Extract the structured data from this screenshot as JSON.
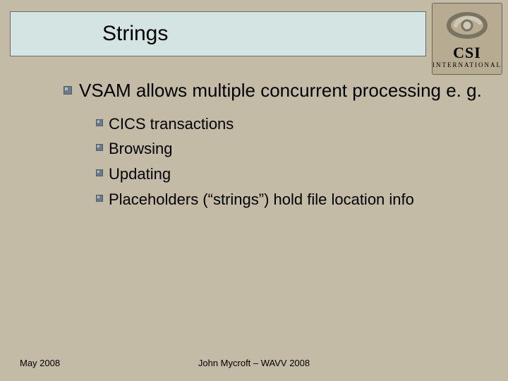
{
  "title": "Strings",
  "logo": {
    "line1": "CSI",
    "line2": "INTERNATIONAL"
  },
  "bullets": {
    "level1": "VSAM allows multiple concurrent processing e. g.",
    "level2": [
      "CICS transactions",
      "Browsing",
      "Updating",
      "Placeholders (“strings”) hold file location info"
    ]
  },
  "footer": {
    "left": "May 2008",
    "center": "John Mycroft – WAVV 2008"
  }
}
